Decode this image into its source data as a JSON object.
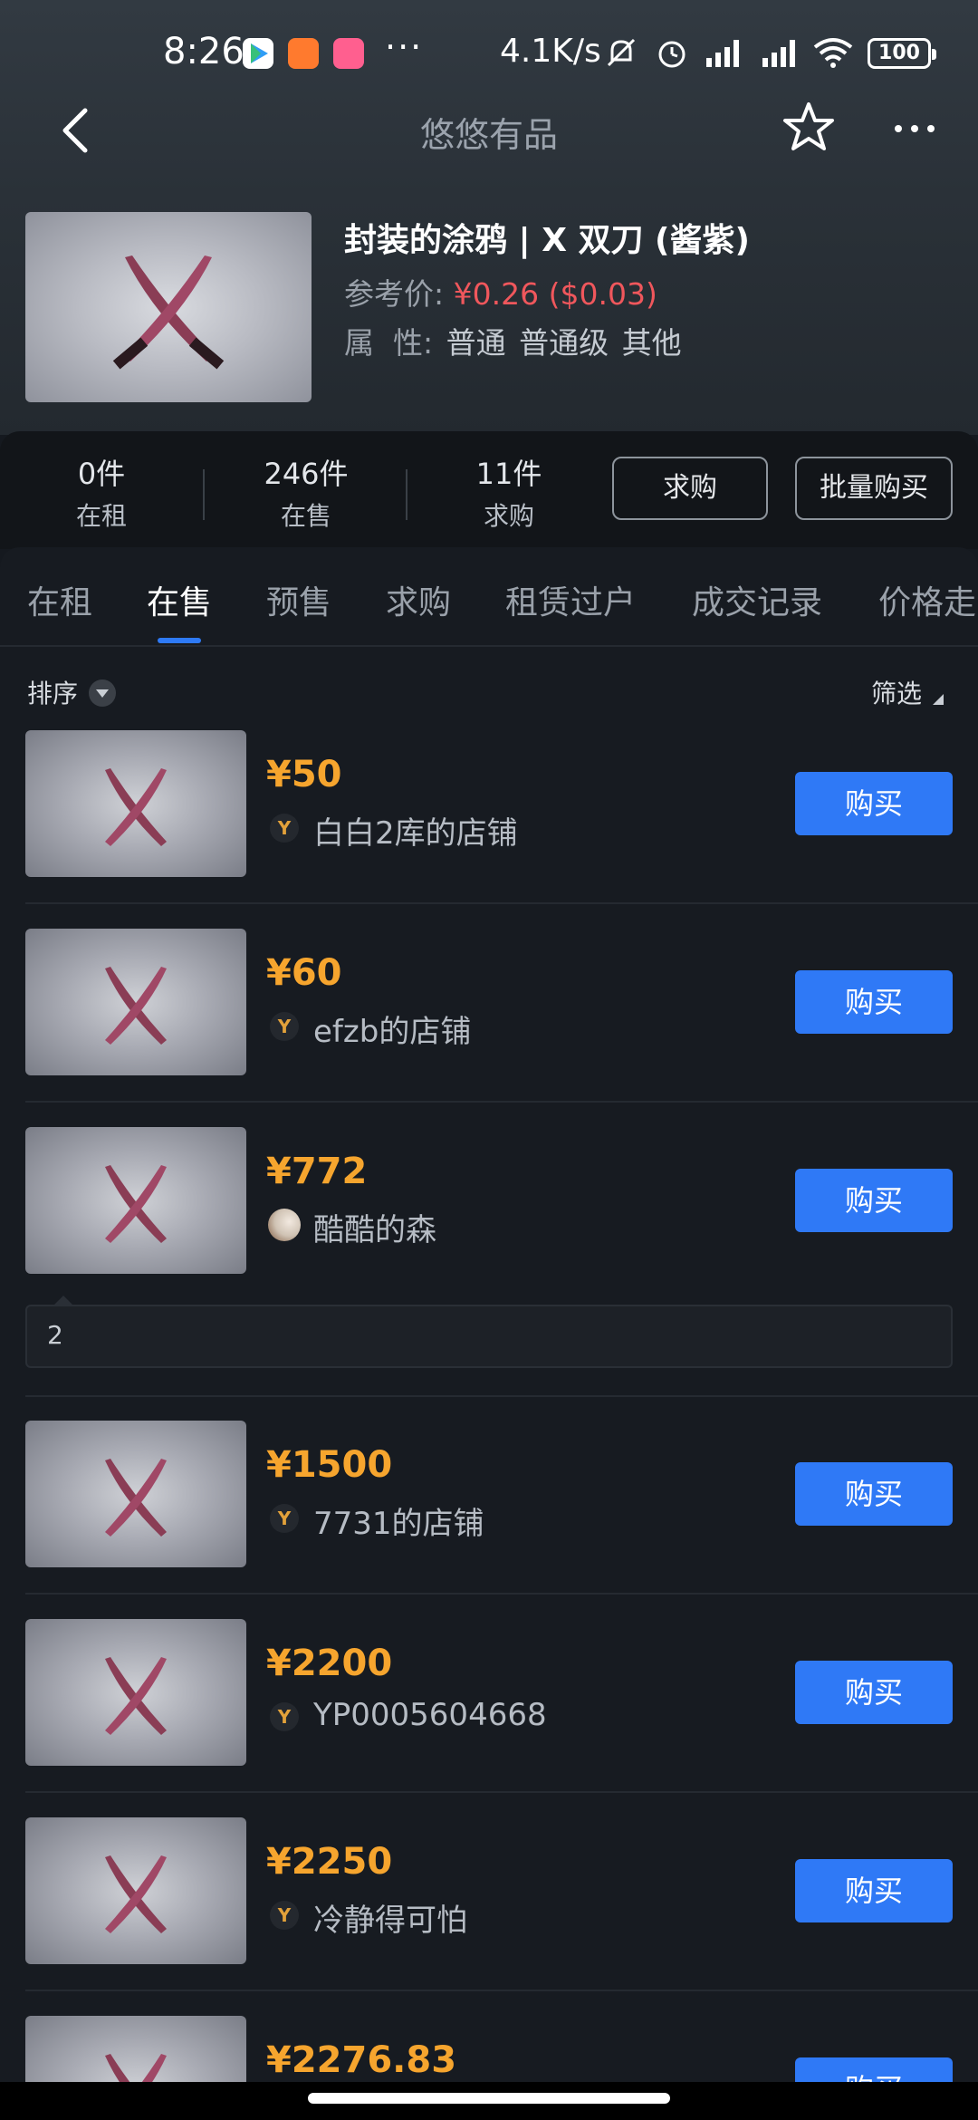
{
  "status_bar": {
    "time": "8:26",
    "dots": "···",
    "speed": "4.1K/s",
    "battery": "100"
  },
  "nav": {
    "title": "悠悠有品"
  },
  "product": {
    "name": "封装的涂鸦 | X 双刀 (酱紫)",
    "ref_label": "参考价:",
    "ref_price": "¥0.26",
    "ref_usd": "($0.03)",
    "attr_label": "属  性:",
    "attr_values": [
      "普通",
      "普通级",
      "其他"
    ]
  },
  "stats": [
    {
      "num": "0件",
      "label": "在租"
    },
    {
      "num": "246件",
      "label": "在售"
    },
    {
      "num": "11件",
      "label": "求购"
    }
  ],
  "actions": {
    "request_label": "求购",
    "bulk_buy_label": "批量购买"
  },
  "tabs": [
    "在租",
    "在售",
    "预售",
    "求购",
    "租赁过户",
    "成交记录",
    "价格走"
  ],
  "active_tab": "在售",
  "list_controls": {
    "sort_label": "排序",
    "filter_label": "筛选"
  },
  "listings": [
    {
      "price": "¥50",
      "shop": "白白2库的店铺",
      "badge": "Y",
      "buy_label": "购买"
    },
    {
      "price": "¥60",
      "shop": "efzb的店铺",
      "badge": "Y",
      "buy_label": "购买"
    },
    {
      "price": "¥772",
      "shop": "酷酷的森",
      "badge": "",
      "buy_label": "购买"
    },
    {
      "price": "¥1500",
      "shop": "7731的店铺",
      "badge": "Y",
      "buy_label": "购买"
    },
    {
      "price": "¥2200",
      "shop": "YP0005604668",
      "badge": "Y",
      "buy_label": "购买"
    },
    {
      "price": "¥2250",
      "shop": "冷静得可怕",
      "badge": "Y",
      "buy_label": "购买"
    },
    {
      "price": "¥2276.83",
      "shop": "",
      "badge": "",
      "buy_label": "购买"
    }
  ],
  "note": {
    "text": "2"
  },
  "colors": {
    "accent": "#2f79f6",
    "price": "#f6a52e",
    "ref_price": "#f0575c",
    "background": "#171b21"
  }
}
